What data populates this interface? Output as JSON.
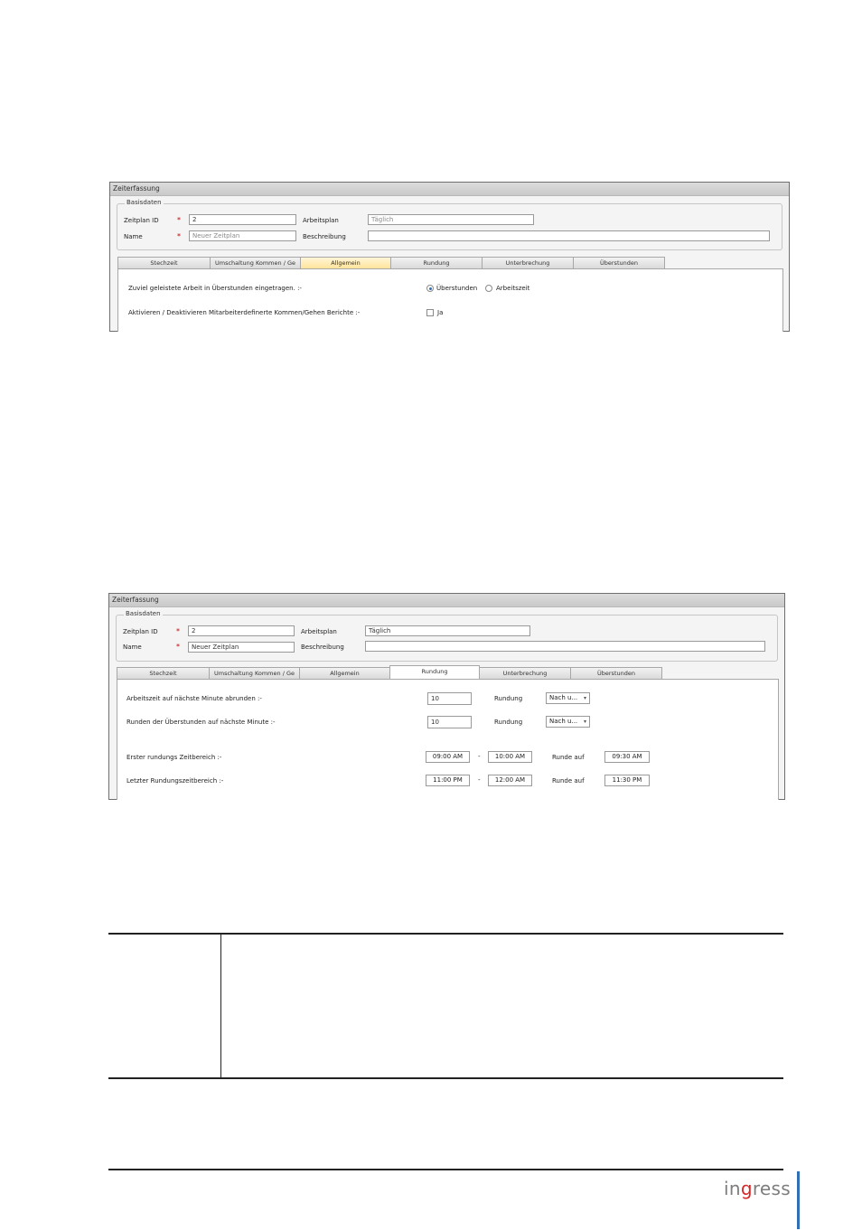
{
  "panel1": {
    "title": "Zeiterfassung",
    "group_legend": "Basisdaten",
    "zeitplan_id_label": "Zeitplan ID",
    "zeitplan_id_value": "2",
    "name_label": "Name",
    "name_placeholder": "Neuer Zeitplan",
    "required_mark": "*",
    "arbeitsplan_label": "Arbeitsplan",
    "arbeitsplan_value": "Täglich",
    "beschreibung_label": "Beschreibung",
    "beschreibung_value": "",
    "tabs": [
      "Stechzeit",
      "Umschaltung Kommen / Ge",
      "Allgemein",
      "Rundung",
      "Unterbrechung",
      "Überstunden"
    ],
    "active_tab": "Allgemein",
    "row1_label": "Zuviel geleistete Arbeit in Überstunden eingetragen. :-",
    "radio_option1": "Überstunden",
    "radio_option2": "Arbeitszeit",
    "radio_selected": "Überstunden",
    "row2_label": "Aktivieren / Deaktivieren Mitarbeiterdefinerte Kommen/Gehen Berichte :-",
    "checkbox_label": "Ja",
    "checkbox_checked": false
  },
  "panel2": {
    "title": "Zeiterfassung",
    "group_legend": "Basisdaten",
    "zeitplan_id_label": "Zeitplan ID",
    "zeitplan_id_value": "2",
    "name_label": "Name",
    "name_value": "Neuer Zeitplan",
    "required_mark": "*",
    "arbeitsplan_label": "Arbeitsplan",
    "arbeitsplan_value": "Täglich",
    "beschreibung_label": "Beschreibung",
    "beschreibung_value": "",
    "tabs": [
      "Stechzeit",
      "Umschaltung Kommen / Ge",
      "Allgemein",
      "Rundung",
      "Unterbrechung",
      "Überstunden"
    ],
    "active_tab": "Rundung",
    "row1_label": "Arbeitszeit auf nächste Minute abrunden :-",
    "row1_value": "10",
    "row1_rundung_label": "Rundung",
    "row1_dropdown": "Nach u...",
    "row2_label": "Runden der Überstunden auf nächste Minute :-",
    "row2_value": "10",
    "row2_rundung_label": "Rundung",
    "row2_dropdown": "Nach u...",
    "row3_label": "Erster rundungs Zeitbereich :-",
    "row3_from": "09:00 AM",
    "row3_sep": "-",
    "row3_to": "10:00 AM",
    "row3_runde_label": "Runde auf",
    "row3_runde_value": "09:30 AM",
    "row4_label": "Letzter Rundungszeitbereich :-",
    "row4_from": "11:00 PM",
    "row4_sep": "-",
    "row4_to": "12:00 AM",
    "row4_runde_label": "Runde auf",
    "row4_runde_value": "11:30 PM"
  },
  "footer": {
    "logo_part1": "in",
    "logo_part2": "g",
    "logo_part3": "ress",
    "accent_color": "#2f6fb4",
    "logo_dot_color": "#d62828"
  }
}
